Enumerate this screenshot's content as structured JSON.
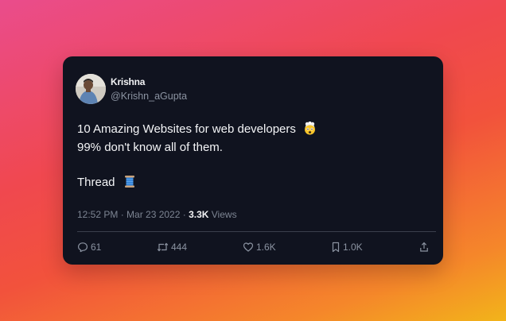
{
  "author": {
    "name": "Krishna",
    "handle": "@Krishn_aGupta"
  },
  "tweet": {
    "line1": "10 Amazing Websites for web developers",
    "line1_emoji": "exploding-head-emoji",
    "line2": "99% don't know all of them.",
    "line3": "Thread",
    "line3_emoji": "thread-spool-emoji"
  },
  "meta": {
    "time_date": "12:52 PM · Mar 23 2022 · ",
    "views_count": "3.3K",
    "views_label": " Views"
  },
  "actions": {
    "replies": "61",
    "retweets": "444",
    "likes": "1.6K",
    "bookmarks": "1.0K"
  },
  "icons": [
    "reply-icon",
    "retweet-icon",
    "like-icon",
    "bookmark-icon",
    "share-icon"
  ],
  "colors": {
    "card_background": "#10131f",
    "text_primary": "#f4f5f7",
    "text_secondary": "#8b93a1",
    "divider": "#3a3f4c"
  }
}
